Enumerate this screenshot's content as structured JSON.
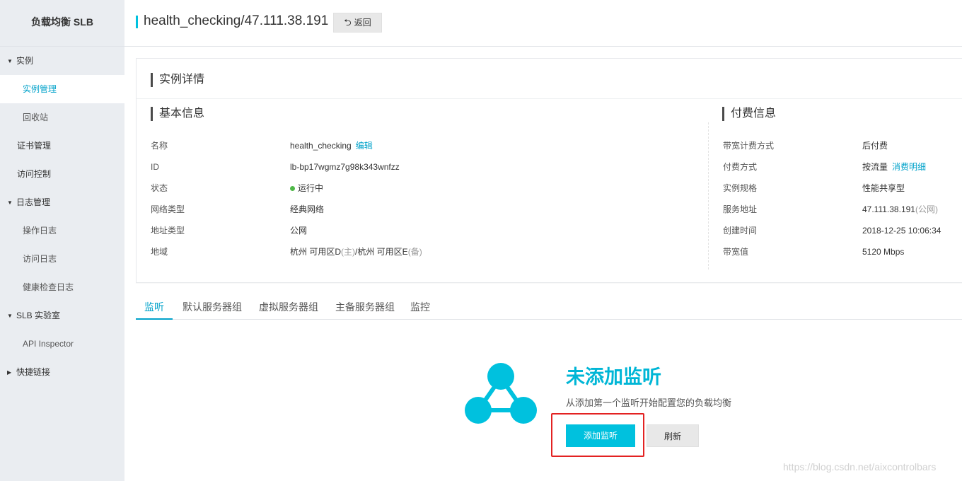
{
  "sidebar": {
    "title": "负载均衡 SLB",
    "groups": {
      "instance": {
        "label": "实例",
        "items": [
          "实例管理",
          "回收站"
        ]
      },
      "cert": {
        "label": "证书管理"
      },
      "access": {
        "label": "访问控制"
      },
      "logs": {
        "label": "日志管理",
        "items": [
          "操作日志",
          "访问日志",
          "健康检查日志"
        ]
      },
      "lab": {
        "label": "SLB 实验室",
        "items": [
          "API Inspector"
        ]
      },
      "quick": {
        "label": "快捷链接"
      }
    },
    "active_item": "实例管理"
  },
  "header": {
    "title": "health_checking/47.111.38.191",
    "back_label": "返回"
  },
  "detail": {
    "title": "实例详情",
    "basic": {
      "title": "基本信息",
      "rows": [
        {
          "label": "名称",
          "value": "health_checking",
          "link": "编辑"
        },
        {
          "label": "ID",
          "value": "lb-bp17wgmz7g98k343wnfzz"
        },
        {
          "label": "状态",
          "value": "运行中"
        },
        {
          "label": "网络类型",
          "value": "经典网络"
        },
        {
          "label": "地址类型",
          "value": "公网"
        },
        {
          "label": "地域",
          "value_main": "杭州 可用区D",
          "value_main_note": "(主)",
          "value_sep": "/杭州 可用区E",
          "value_backup_note": "(备)"
        }
      ]
    },
    "billing": {
      "title": "付费信息",
      "rows": [
        {
          "label": "带宽计费方式",
          "value": "后付费"
        },
        {
          "label": "付费方式",
          "value": "按流量",
          "link": "消费明细"
        },
        {
          "label": "实例规格",
          "value": "性能共享型"
        },
        {
          "label": "服务地址",
          "value": "47.111.38.191",
          "note": "(公网)"
        },
        {
          "label": "创建时间",
          "value": "2018-12-25 10:06:34"
        },
        {
          "label": "带宽值",
          "value": "5120 Mbps"
        }
      ]
    }
  },
  "tabs": [
    "监听",
    "默认服务器组",
    "虚拟服务器组",
    "主备服务器组",
    "监控"
  ],
  "active_tab": "监听",
  "empty_state": {
    "title": "未添加监听",
    "description": "从添加第一个监听开始配置您的负载均衡",
    "primary_label": "添加监听",
    "refresh_label": "刷新"
  },
  "colors": {
    "accent": "#00c1de",
    "link": "#00a2ca",
    "status_running": "#4fb848",
    "highlight": "#e32222"
  },
  "watermark": "https://blog.csdn.net/aixcontrolbars"
}
